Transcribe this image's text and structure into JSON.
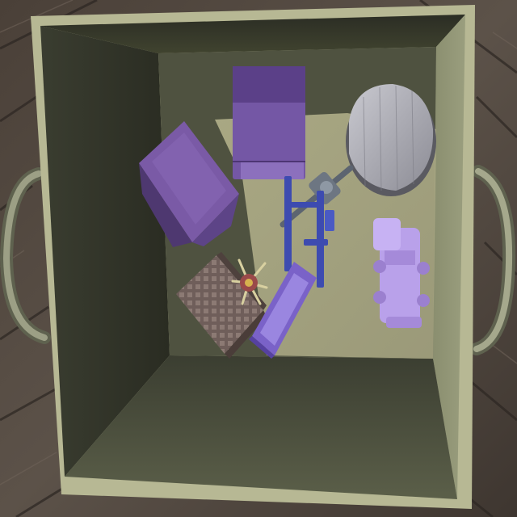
{
  "scene": {
    "objects": [
      {
        "name": "wooden-deck-floor"
      },
      {
        "name": "storage-crate"
      },
      {
        "name": "left-handle"
      },
      {
        "name": "right-handle"
      },
      {
        "name": "purple-box-left"
      },
      {
        "name": "purple-book-top"
      },
      {
        "name": "gray-helmet"
      },
      {
        "name": "toy-guitar"
      },
      {
        "name": "purple-toy-train"
      },
      {
        "name": "brown-waffle-box"
      },
      {
        "name": "spiky-flower-ornament"
      },
      {
        "name": "purple-tray"
      },
      {
        "name": "blue-bracket-piece"
      }
    ]
  }
}
